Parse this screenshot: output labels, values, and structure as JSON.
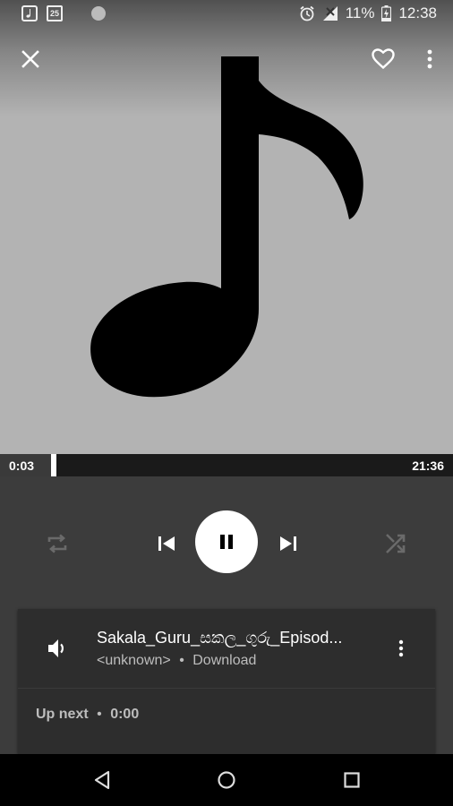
{
  "status_bar": {
    "calendar_day": "25",
    "battery": "11%",
    "clock": "12:38"
  },
  "progress": {
    "elapsed": "0:03",
    "duration": "21:36",
    "fraction": 0.002
  },
  "now_playing": {
    "title": "Sakala_Guru_සකල_ගුරු_Episod...",
    "artist": "<unknown>",
    "separator": "•",
    "source": "Download"
  },
  "up_next": {
    "label": "Up next",
    "separator": "•",
    "time": "0:00"
  },
  "colors": {
    "art_background": "#b3b3b3",
    "player_background": "#3c3c3c",
    "card_background": "#2d2d2d"
  },
  "icons": {
    "close": "close-icon",
    "favorite": "heart-outline-icon",
    "more": "more-vert-icon",
    "repeat": "repeat-icon",
    "previous": "skip-previous-icon",
    "pause": "pause-icon",
    "next": "skip-next-icon",
    "shuffle": "shuffle-icon",
    "volume": "volume-icon",
    "back": "nav-back-icon",
    "home": "nav-home-icon",
    "recents": "nav-recents-icon"
  }
}
